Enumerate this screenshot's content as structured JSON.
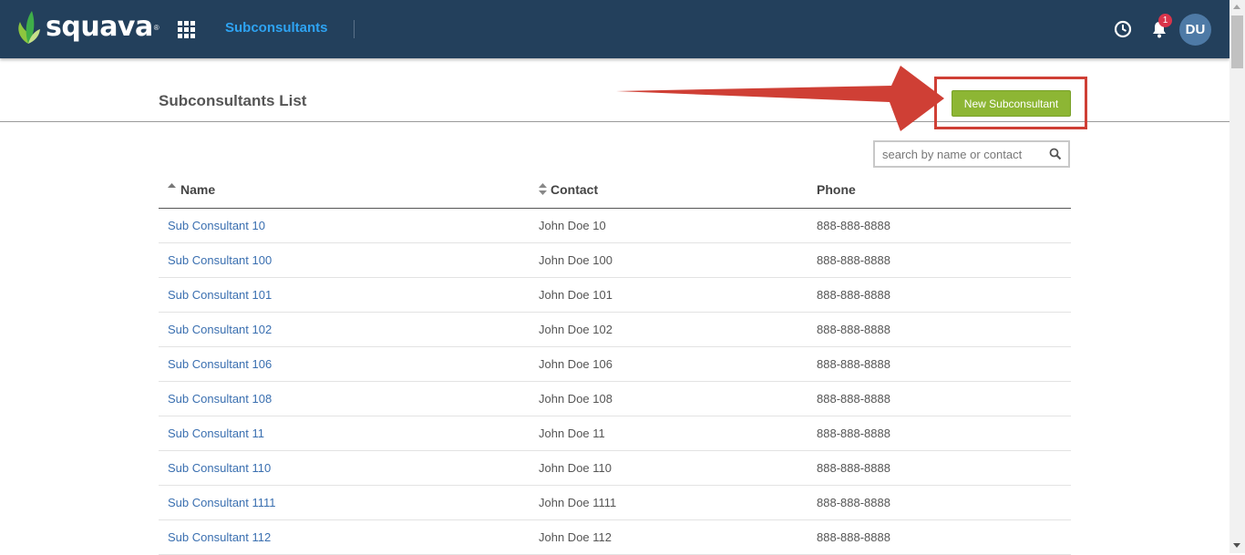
{
  "header": {
    "logo_text": "squava",
    "logo_tm": "®",
    "nav_title": "Subconsultants",
    "notification_count": "1",
    "user_initials": "DU",
    "colors": {
      "bar": "#23405c",
      "nav_accent": "#2ea3f2",
      "badge": "#d9344b",
      "avatar": "#4e7aa6"
    }
  },
  "page": {
    "title": "Subconsultants List",
    "new_button_label": "New Subconsultant",
    "search_placeholder": "search by name or contact",
    "colors": {
      "button": "#8db634",
      "annotation": "#cf3f35",
      "link": "#3a6fb0"
    }
  },
  "table": {
    "columns": [
      "Name",
      "Contact",
      "Phone"
    ],
    "rows": [
      {
        "name": "Sub Consultant 10",
        "contact": "John Doe 10",
        "phone": "888-888-8888"
      },
      {
        "name": "Sub Consultant 100",
        "contact": "John Doe 100",
        "phone": "888-888-8888"
      },
      {
        "name": "Sub Consultant 101",
        "contact": "John Doe 101",
        "phone": "888-888-8888"
      },
      {
        "name": "Sub Consultant 102",
        "contact": "John Doe 102",
        "phone": "888-888-8888"
      },
      {
        "name": "Sub Consultant 106",
        "contact": "John Doe 106",
        "phone": "888-888-8888"
      },
      {
        "name": "Sub Consultant 108",
        "contact": "John Doe 108",
        "phone": "888-888-8888"
      },
      {
        "name": "Sub Consultant 11",
        "contact": "John Doe 11",
        "phone": "888-888-8888"
      },
      {
        "name": "Sub Consultant 110",
        "contact": "John Doe 110",
        "phone": "888-888-8888"
      },
      {
        "name": "Sub Consultant 1111",
        "contact": "John Doe 1111",
        "phone": "888-888-8888"
      },
      {
        "name": "Sub Consultant 112",
        "contact": "John Doe 112",
        "phone": "888-888-8888"
      }
    ]
  }
}
